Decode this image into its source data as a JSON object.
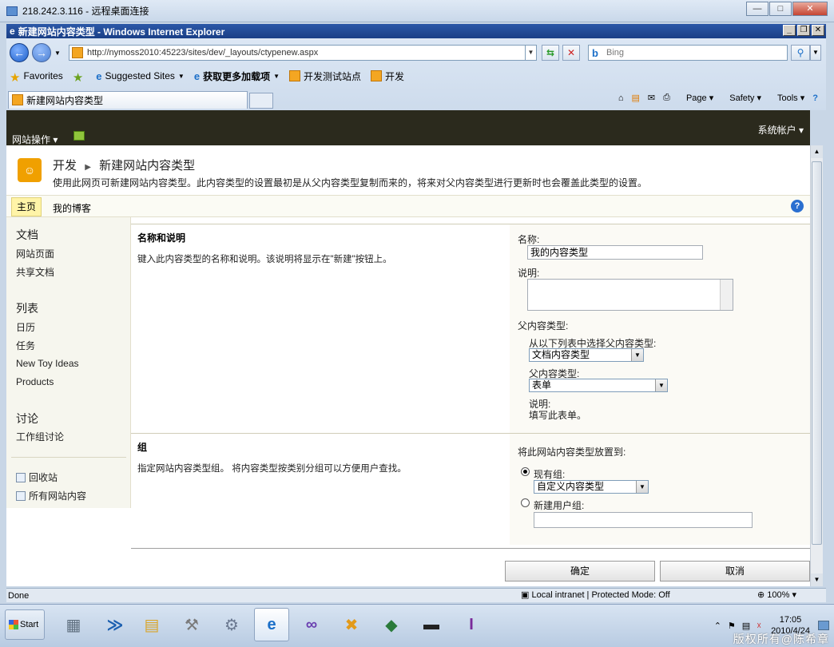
{
  "rdp_window": {
    "title": "218.242.3.116 - 远程桌面连接"
  },
  "ie_window": {
    "title": "新建网站内容类型 - Windows Internet Explorer",
    "address": "http://nymoss2010:45223/sites/dev/_layouts/ctypenew.aspx",
    "search_placeholder": "Bing",
    "favorites": {
      "favorites_label": "Favorites",
      "suggested_sites": "Suggested Sites",
      "get_addons": "获取更多加载项",
      "test_site": "开发测试站点",
      "dev": "开发"
    },
    "tab_label": "新建网站内容类型",
    "commands": {
      "page": "Page",
      "safety": "Safety",
      "tools": "Tools"
    }
  },
  "sharepoint": {
    "site_actions": "网站操作",
    "account": "系统帐户",
    "breadcrumb": {
      "site": "开发",
      "page": "新建网站内容类型"
    },
    "page_description": "使用此网页可新建网站内容类型。此内容类型的设置最初是从父内容类型复制而来的，将来对父内容类型进行更新时也会覆盖此类型的设置。",
    "top_nav": {
      "home": "主页",
      "blog": "我的博客"
    },
    "left_nav": {
      "docs_header": "文档",
      "site_pages": "网站页面",
      "shared_docs": "共享文档",
      "lists_header": "列表",
      "calendar": "日历",
      "tasks": "任务",
      "toy_ideas": "New Toy Ideas",
      "products": "Products",
      "discussions_header": "讨论",
      "team_discussion": "工作组讨论",
      "recycle_bin": "回收站",
      "all_content": "所有网站内容"
    },
    "section_name": {
      "title": "名称和说明",
      "description": "键入此内容类型的名称和说明。该说明将显示在\"新建\"按钮上。",
      "name_label": "名称:",
      "name_value": "我的内容类型",
      "desc_label": "说明:",
      "desc_value": "",
      "parent_label": "父内容类型:",
      "select_from_label": "从以下列表中选择父内容类型:",
      "select_from_value": "文档内容类型",
      "parent_type_label": "父内容类型:",
      "parent_type_value": "表单",
      "parent_desc_label": "说明:",
      "parent_desc_value": "填写此表单。"
    },
    "section_group": {
      "title": "组",
      "description": "指定网站内容类型组。 将内容类型按类别分组可以方便用户查找。",
      "put_into_label": "将此网站内容类型放置到:",
      "existing_group_label": "现有组:",
      "existing_group_value": "自定义内容类型",
      "new_group_label": "新建用户组:",
      "new_group_value": ""
    },
    "buttons": {
      "ok": "确定",
      "cancel": "取消"
    }
  },
  "status_bar": {
    "status": "Done",
    "zone": "Local intranet | Protected Mode: Off",
    "zoom": "100%"
  },
  "taskbar": {
    "start": "Start",
    "time": "17:05",
    "date": "2010/4/24",
    "watermark": "版权所有@陈希章"
  }
}
